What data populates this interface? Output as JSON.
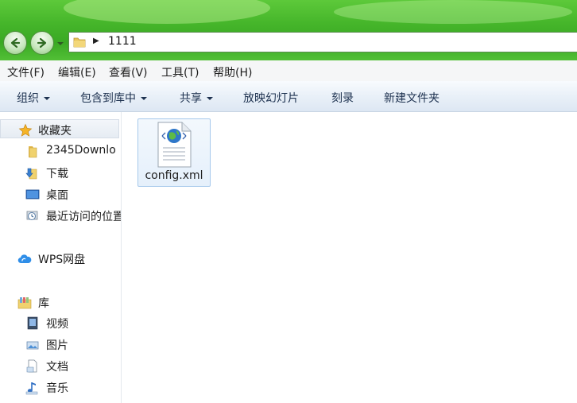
{
  "address": {
    "path": "1111"
  },
  "menu": [
    "文件(F)",
    "编辑(E)",
    "查看(V)",
    "工具(T)",
    "帮助(H)"
  ],
  "commands": {
    "organize": "组织",
    "include_library": "包含到库中",
    "share": "共享",
    "slideshow": "放映幻灯片",
    "burn": "刻录",
    "new_folder": "新建文件夹"
  },
  "nav": {
    "favorites": "收藏夹",
    "fav_items": [
      "2345Downlo",
      "下载",
      "桌面",
      "最近访问的位置"
    ],
    "wps": "WPS网盘",
    "library": "库",
    "lib_items": [
      "视频",
      "图片",
      "文档",
      "音乐"
    ]
  },
  "files": [
    {
      "name": "config.xml"
    }
  ],
  "colors": {
    "accent_green": "#45b52a",
    "selection_blue": "#a7c9ec",
    "command_text": "#1e3250"
  }
}
